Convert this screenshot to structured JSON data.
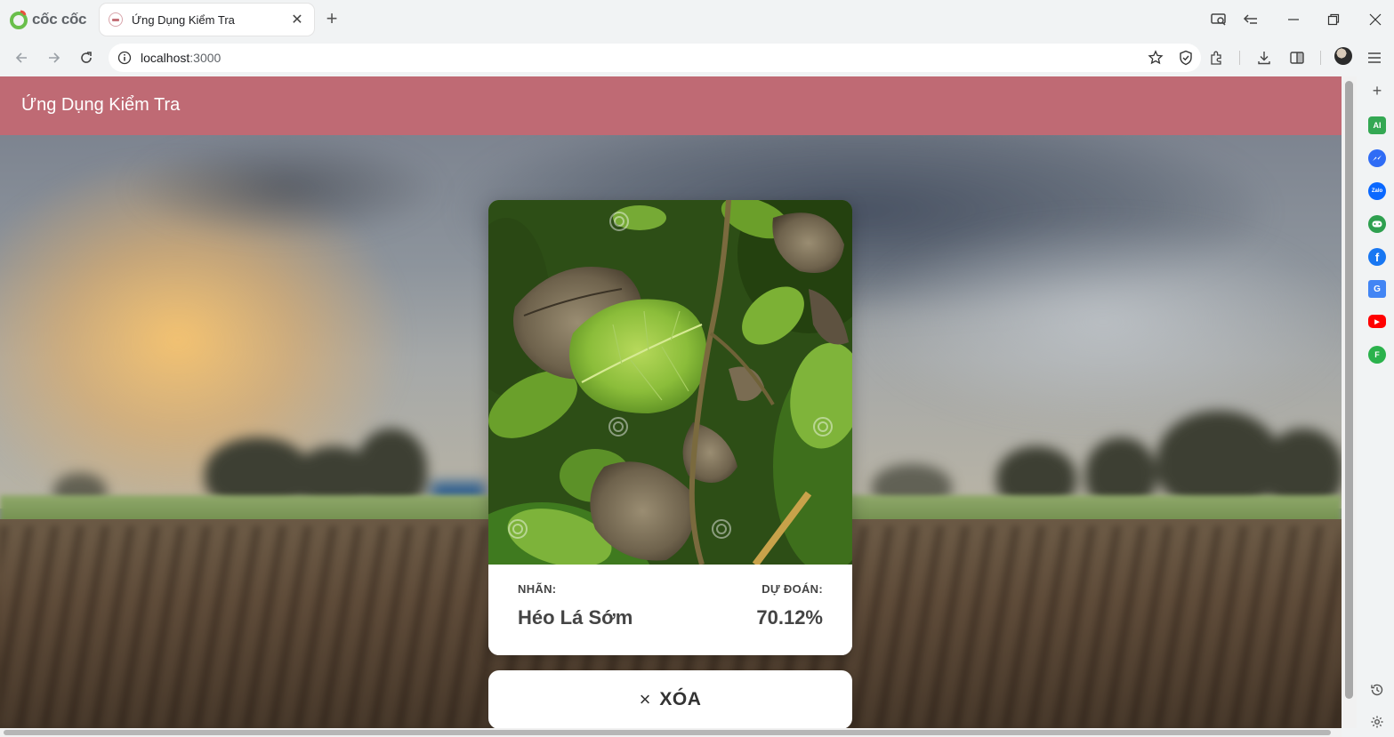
{
  "browser": {
    "brand": "cốc cốc",
    "tab": {
      "title": "Ứng Dụng Kiểm Tra"
    },
    "address": "localhost:3000",
    "address_parts": {
      "host": "localhost",
      "port": ":3000"
    }
  },
  "app": {
    "title": "Ứng Dụng Kiểm Tra",
    "result": {
      "label_heading": "NHÃN:",
      "label_value": "Héo Lá Sớm",
      "prediction_heading": "DỰ ĐOÁN:",
      "prediction_value": "70.12%"
    },
    "clear_button": {
      "icon": "×",
      "label": "XÓA"
    }
  },
  "sidebar": {
    "items": [
      {
        "name": "ai",
        "text": "AI",
        "color": "#34a853"
      },
      {
        "name": "messenger",
        "text": "",
        "color": "#2f6cf5"
      },
      {
        "name": "zalo",
        "text": "Zalo",
        "color": "#0a68ff"
      },
      {
        "name": "game",
        "text": "",
        "color": "#2ea04f"
      },
      {
        "name": "facebook",
        "text": "f",
        "color": "#1877f2"
      },
      {
        "name": "translate",
        "text": "G",
        "color": "#4285f4"
      },
      {
        "name": "youtube",
        "text": "▶",
        "color": "#ff0000"
      },
      {
        "name": "feedly",
        "text": "F",
        "color": "#2bb24c"
      }
    ]
  },
  "colors": {
    "app_header": "#bf6a74",
    "card": "#ffffff"
  }
}
